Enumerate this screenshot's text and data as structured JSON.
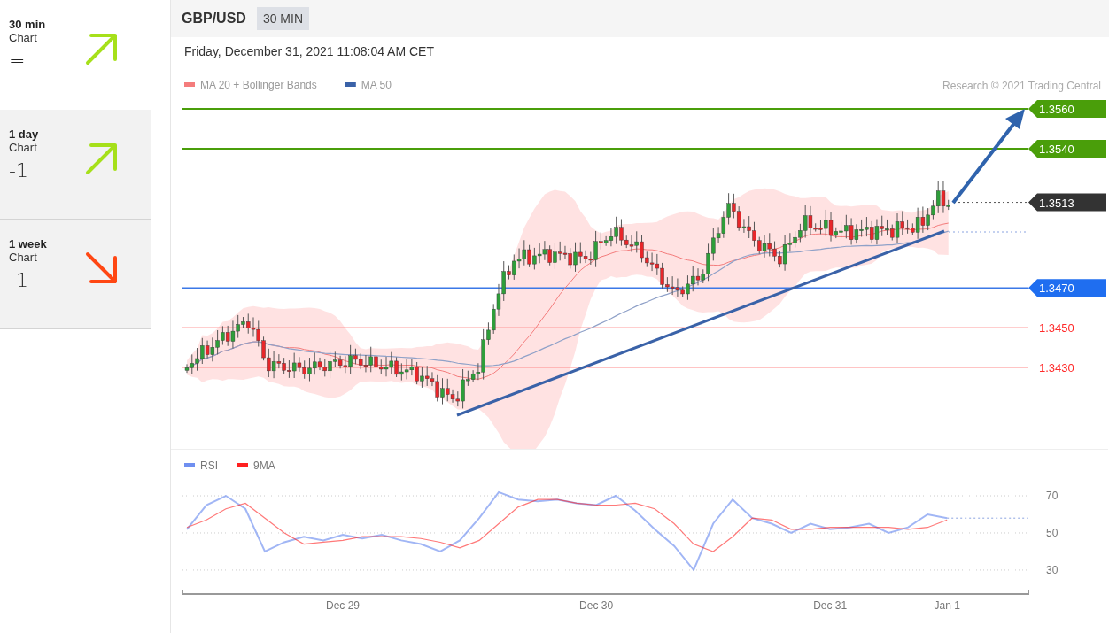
{
  "sidebar": {
    "items": [
      {
        "label": "30 min",
        "sublabel": "Chart",
        "signal": "=",
        "kind": "up",
        "selected": true
      },
      {
        "label": "1 day",
        "sublabel": "Chart",
        "signal": "-1",
        "kind": "up",
        "selected": false
      },
      {
        "label": "1 week",
        "sublabel": "Chart",
        "signal": "-1",
        "kind": "down",
        "selected": false
      }
    ]
  },
  "header": {
    "symbol": "GBP/USD",
    "interval": "30 MIN"
  },
  "timestamp": "Friday, December 31, 2021 11:08:04 AM CET",
  "price_chart": {
    "legend": [
      {
        "label": "MA 20 + Bollinger Bands",
        "color": "#f47c7c"
      },
      {
        "label": "MA 50",
        "color": "#3a62a8"
      }
    ],
    "credit": "Research © 2021 Trading Central",
    "levels": [
      {
        "kind": "resistance",
        "label": "1.3560"
      },
      {
        "kind": "resistance",
        "label": "1.3540"
      },
      {
        "kind": "current",
        "label": "1.3513"
      },
      {
        "kind": "pivot",
        "label": "1.3470"
      },
      {
        "kind": "support",
        "label": "1.3450"
      },
      {
        "kind": "support",
        "label": "1.3430"
      }
    ]
  },
  "rsi_panel": {
    "chart_data": {
      "type": "line",
      "categories": [
        null,
        null,
        null,
        null,
        null,
        null,
        null,
        null,
        "Dec 29",
        null,
        null,
        null,
        null,
        null,
        null,
        null,
        null,
        null,
        null,
        null,
        null,
        "Dec 30",
        null,
        null,
        null,
        null,
        null,
        null,
        null,
        null,
        null,
        null,
        null,
        "Dec 31",
        null,
        null,
        null,
        null,
        null,
        "Jan 1"
      ],
      "series": [
        {
          "name": "RSI",
          "color": "#6f8ff0",
          "values": [
            52,
            65,
            70,
            63,
            40,
            45,
            48,
            46,
            49,
            47,
            49,
            46,
            44,
            40,
            46,
            58,
            72,
            68,
            67,
            68,
            66,
            65,
            70,
            62,
            52,
            43,
            30,
            55,
            68,
            58,
            55,
            50,
            55,
            52,
            53,
            55,
            50,
            53,
            60,
            58
          ]
        },
        {
          "name": "9MA",
          "color": "#ff2020",
          "values": [
            53,
            57,
            63,
            66,
            58,
            50,
            44,
            45,
            46,
            48,
            48,
            48,
            47,
            45,
            42,
            46,
            55,
            64,
            68,
            68,
            66,
            65,
            65,
            66,
            63,
            55,
            44,
            40,
            48,
            58,
            57,
            52,
            52,
            53,
            53,
            53,
            53,
            52,
            53,
            57
          ]
        }
      ],
      "ylim": [
        17.1,
        94.8
      ],
      "yticks": [
        30,
        50,
        70
      ],
      "grid": true,
      "legend": "upper left"
    }
  }
}
